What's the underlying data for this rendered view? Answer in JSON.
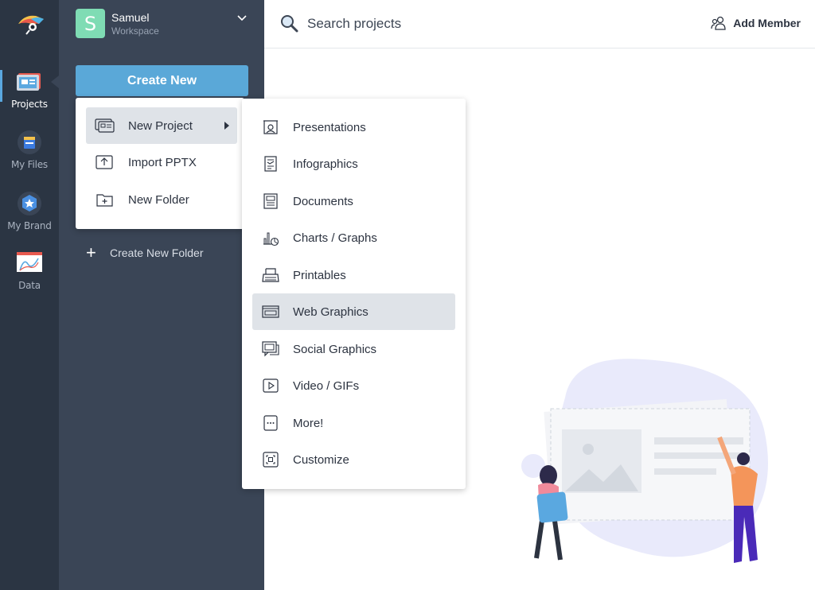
{
  "rail": {
    "items": [
      {
        "label": "Projects",
        "icon": "projects-icon",
        "active": true
      },
      {
        "label": "My Files",
        "icon": "my-files-icon",
        "active": false
      },
      {
        "label": "My Brand",
        "icon": "my-brand-icon",
        "active": false
      },
      {
        "label": "Data",
        "icon": "data-icon",
        "active": false
      }
    ]
  },
  "workspace": {
    "initial": "S",
    "name": "Samuel",
    "subtitle": "Workspace",
    "avatar_color": "#7fdcb4"
  },
  "sidebar": {
    "create_button": "Create New",
    "create_folder": "Create New Folder"
  },
  "topbar": {
    "search_placeholder": "Search projects",
    "add_member": "Add Member"
  },
  "create_menu": {
    "items": [
      {
        "label": "New Project",
        "icon": "new-project-icon",
        "active": true,
        "has_submenu": true
      },
      {
        "label": "Import PPTX",
        "icon": "upload-icon",
        "active": false
      },
      {
        "label": "New Folder",
        "icon": "new-folder-icon",
        "active": false
      }
    ]
  },
  "project_submenu": {
    "items": [
      {
        "label": "Presentations",
        "icon": "presentation-icon"
      },
      {
        "label": "Infographics",
        "icon": "infographic-icon"
      },
      {
        "label": "Documents",
        "icon": "document-icon"
      },
      {
        "label": "Charts / Graphs",
        "icon": "chart-icon"
      },
      {
        "label": "Printables",
        "icon": "printer-icon"
      },
      {
        "label": "Web Graphics",
        "icon": "web-graphics-icon",
        "active": true
      },
      {
        "label": "Social Graphics",
        "icon": "social-icon"
      },
      {
        "label": "Video / GIFs",
        "icon": "video-icon"
      },
      {
        "label": "More!",
        "icon": "more-icon"
      },
      {
        "label": "Customize",
        "icon": "customize-icon"
      }
    ]
  },
  "colors": {
    "rail_bg": "#2b3543",
    "sidebar_bg": "#3a4556",
    "accent": "#5aa8d8",
    "highlight": "#dfe3e8"
  }
}
